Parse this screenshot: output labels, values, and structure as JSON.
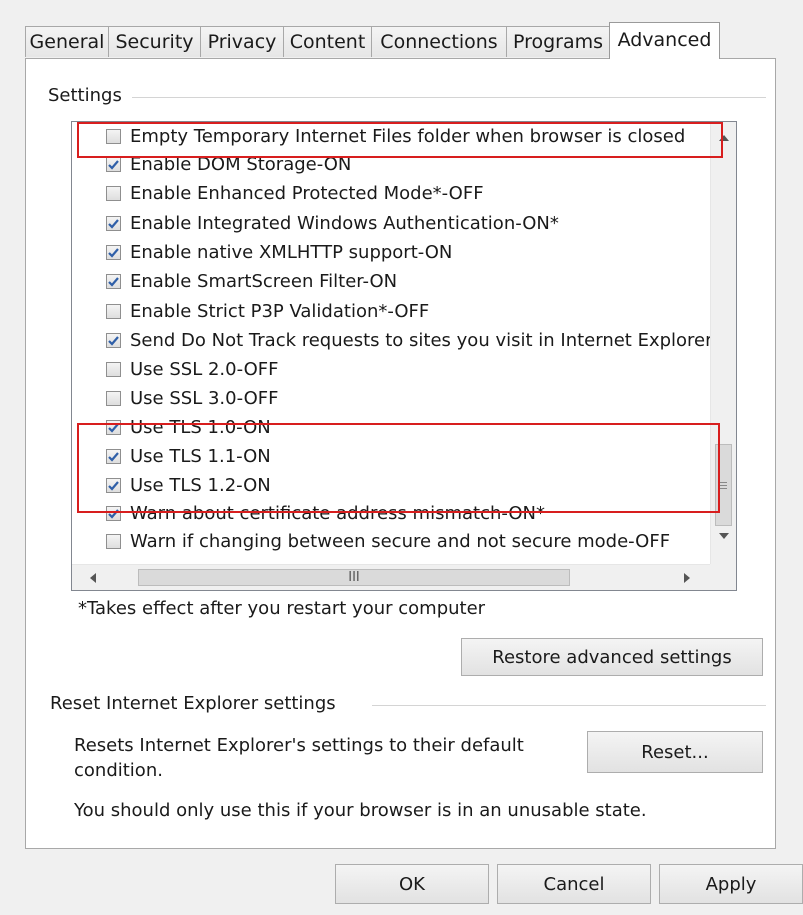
{
  "tabs": [
    {
      "label": "General",
      "active": false
    },
    {
      "label": "Security",
      "active": false
    },
    {
      "label": "Privacy",
      "active": false
    },
    {
      "label": "Content",
      "active": false
    },
    {
      "label": "Connections",
      "active": false
    },
    {
      "label": "Programs",
      "active": false
    },
    {
      "label": "Advanced",
      "active": true
    }
  ],
  "settings_group": {
    "label": "Settings",
    "items": [
      {
        "label": "Empty Temporary Internet Files folder when browser is closed",
        "checked": false
      },
      {
        "label": "Enable DOM Storage-ON",
        "checked": true
      },
      {
        "label": "Enable Enhanced Protected Mode*-OFF",
        "checked": false
      },
      {
        "label": "Enable Integrated Windows Authentication-ON*",
        "checked": true
      },
      {
        "label": "Enable native XMLHTTP support-ON",
        "checked": true
      },
      {
        "label": "Enable SmartScreen Filter-ON",
        "checked": true
      },
      {
        "label": "Enable Strict P3P Validation*-OFF",
        "checked": false
      },
      {
        "label": "Send Do Not Track requests to sites you visit in Internet Explorer",
        "checked": true
      },
      {
        "label": "Use SSL 2.0-OFF",
        "checked": false
      },
      {
        "label": "Use SSL 3.0-OFF",
        "checked": false
      },
      {
        "label": "Use TLS 1.0-ON",
        "checked": true
      },
      {
        "label": "Use TLS 1.1-ON",
        "checked": true
      },
      {
        "label": "Use TLS 1.2-ON",
        "checked": true
      },
      {
        "label": "Warn about certificate address mismatch-ON*",
        "checked": true
      },
      {
        "label": "Warn if changing between secure and not secure mode-OFF",
        "checked": false
      }
    ],
    "scrollbar_thumb_label": "III",
    "restart_note": "*Takes effect after you restart your computer",
    "restore_button": "Restore advanced settings"
  },
  "reset_group": {
    "label": "Reset Internet Explorer settings",
    "description_line1": "Resets Internet Explorer's settings to their default",
    "description_line2": "condition.",
    "reset_button": "Reset...",
    "warning": "You should only use this if your browser is in an unusable state."
  },
  "footer": {
    "ok": "OK",
    "cancel": "Cancel",
    "apply": "Apply"
  },
  "colors": {
    "highlight": "#d81e1e",
    "checkmark": "#2f5fa8"
  },
  "icons": {
    "checkbox_checked": "checkmark-icon",
    "scroll_up": "triangle-up-icon",
    "scroll_down": "triangle-down-icon",
    "scroll_left": "triangle-left-icon",
    "scroll_right": "triangle-right-icon"
  }
}
